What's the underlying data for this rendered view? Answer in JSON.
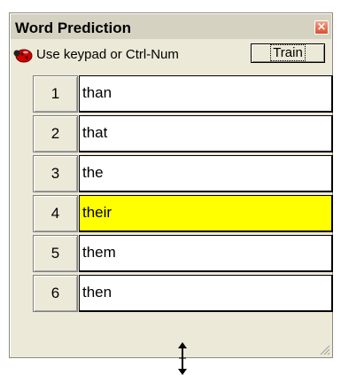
{
  "window": {
    "title": "Word Prediction",
    "close_glyph": "×"
  },
  "toolbar": {
    "icon": "ladybug-icon",
    "hint": "Use keypad or Ctrl-Num",
    "train_label": "Train"
  },
  "predictions": [
    {
      "num": "1",
      "word": "than"
    },
    {
      "num": "2",
      "word": "that"
    },
    {
      "num": "3",
      "word": "the"
    },
    {
      "num": "4",
      "word": "their"
    },
    {
      "num": "5",
      "word": "them"
    },
    {
      "num": "6",
      "word": "then"
    }
  ],
  "selected_index": 3,
  "colors": {
    "selected_bg": "#ffff00",
    "window_bg": "#ece9d8",
    "close_btn": "#d9502d"
  }
}
